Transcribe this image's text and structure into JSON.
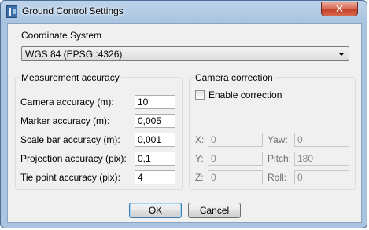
{
  "window": {
    "title": "Ground Control Settings",
    "close_label": "✕"
  },
  "coordinate_system": {
    "label": "Coordinate System",
    "selected": "WGS 84 (EPSG::4326)"
  },
  "measurement_accuracy": {
    "title": "Measurement accuracy",
    "fields": [
      {
        "label": "Camera accuracy (m):",
        "value": "10"
      },
      {
        "label": "Marker accuracy (m):",
        "value": "0,005"
      },
      {
        "label": "Scale bar accuracy (m):",
        "value": "0,001"
      },
      {
        "label": "Projection accuracy (pix):",
        "value": "0,1"
      },
      {
        "label": "Tie point accuracy (pix):",
        "value": "4"
      }
    ]
  },
  "camera_correction": {
    "title": "Camera correction",
    "enable_label": "Enable correction",
    "enabled": false,
    "x": {
      "label": "X:",
      "value": "0"
    },
    "y": {
      "label": "Y:",
      "value": "0"
    },
    "z": {
      "label": "Z:",
      "value": "0"
    },
    "yaw": {
      "label": "Yaw:",
      "value": "0"
    },
    "pitch": {
      "label": "Pitch:",
      "value": "180"
    },
    "roll": {
      "label": "Roll:",
      "value": "0"
    }
  },
  "buttons": {
    "ok": "OK",
    "cancel": "Cancel"
  }
}
